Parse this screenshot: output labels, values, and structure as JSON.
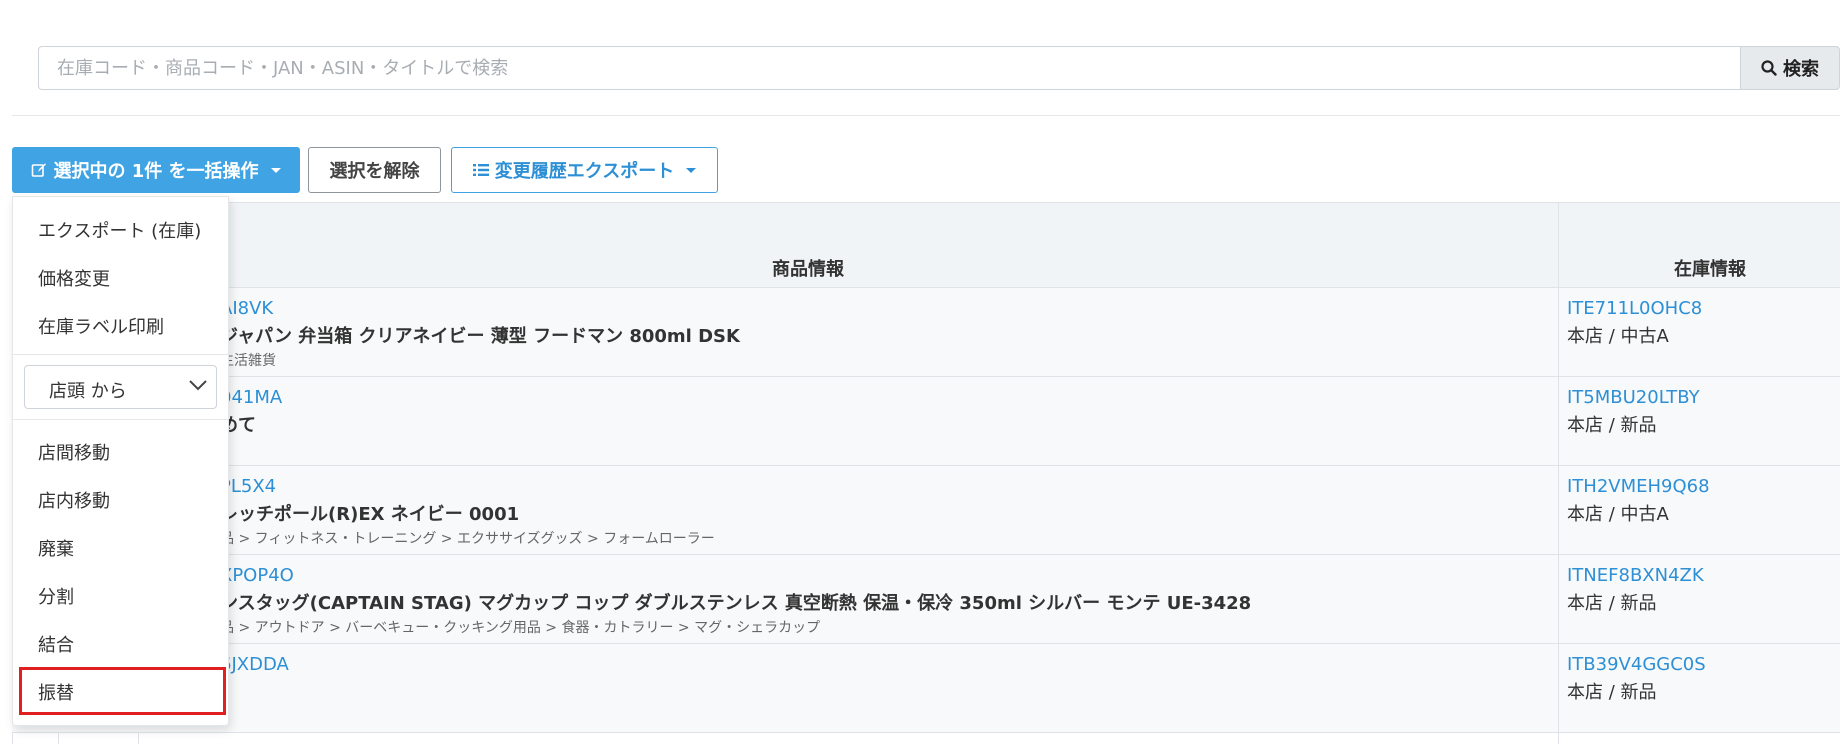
{
  "search": {
    "placeholder": "在庫コード・商品コード・JAN・ASIN・タイトルで検索",
    "button_label": "検索"
  },
  "toolbar": {
    "bulk_label": "選択中の 1件 を一括操作",
    "clear_label": "選択を解除",
    "export_label": "変更履歴エクスポート"
  },
  "table": {
    "headers": {
      "product": "商品情報",
      "stock": "在庫情報"
    },
    "rows": [
      {
        "code": "AI8VK",
        "title": "ジャパン 弁当箱 クリアネイビー 薄型 フードマン 800ml DSK",
        "category": "生活雑貨",
        "stock_code": "ITE711L0OHC8",
        "stock_loc": "本店 / 中古A"
      },
      {
        "code": "041MA",
        "title": "めて",
        "category": "",
        "stock_code": "IT5MBU20LTBY",
        "stock_loc": "本店 / 新品"
      },
      {
        "code": "PL5X4",
        "title": "レッチポール(R)EX ネイビー 0001",
        "category": "品 > フィットネス・トレーニング > エクササイズグッズ > フォームローラー",
        "stock_code": "ITH2VMEH9Q68",
        "stock_loc": "本店 / 中古A"
      },
      {
        "code": "XPOP4O",
        "title": "ンスタッグ(CAPTAIN STAG) マグカップ コップ ダブルステンレス 真空断熱 保温・保冷 350ml シルバー モンテ UE-3428",
        "category": "品 > アウトドア > バーベキュー・クッキング用品 > 食器・カトラリー > マグ・シェラカップ",
        "stock_code": "ITNEF8BXN4ZK",
        "stock_loc": "本店 / 新品"
      },
      {
        "code": "6JXDDA",
        "title": "",
        "category": "",
        "stock_code": "ITB39V4GGC0S",
        "stock_loc": "本店 / 新品"
      }
    ]
  },
  "dropdown": {
    "items_top": [
      "エクスポート (在庫)",
      "価格変更",
      "在庫ラベル印刷"
    ],
    "select_value": "店頭 から",
    "items_bottom": [
      "店間移動",
      "店内移動",
      "廃棄",
      "分割",
      "結合",
      "振替"
    ]
  },
  "colors": {
    "primary": "#3fa3e4",
    "link": "#2d8fd5",
    "highlight": "#e02020"
  }
}
